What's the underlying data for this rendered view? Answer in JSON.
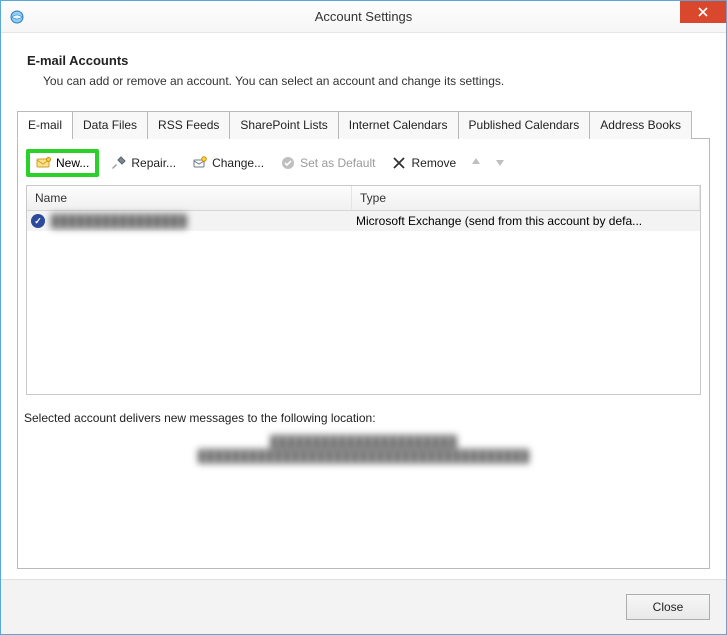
{
  "window": {
    "title": "Account Settings"
  },
  "header": {
    "title": "E-mail Accounts",
    "description": "You can add or remove an account. You can select an account and change its settings."
  },
  "tabs": [
    {
      "label": "E-mail",
      "active": true
    },
    {
      "label": "Data Files"
    },
    {
      "label": "RSS Feeds"
    },
    {
      "label": "SharePoint Lists"
    },
    {
      "label": "Internet Calendars"
    },
    {
      "label": "Published Calendars"
    },
    {
      "label": "Address Books"
    }
  ],
  "toolbar": {
    "new_label": "New...",
    "repair_label": "Repair...",
    "change_label": "Change...",
    "set_default_label": "Set as Default",
    "remove_label": "Remove"
  },
  "list": {
    "columns": {
      "name": "Name",
      "type": "Type"
    },
    "rows": [
      {
        "name": "████████████████",
        "type": "Microsoft Exchange (send from this account by defa..."
      }
    ]
  },
  "footer": {
    "message": "Selected account delivers new messages to the following location:",
    "location_title": "██████████████████████",
    "location_detail": "███████████████████████████████████████"
  },
  "buttons": {
    "close": "Close"
  }
}
